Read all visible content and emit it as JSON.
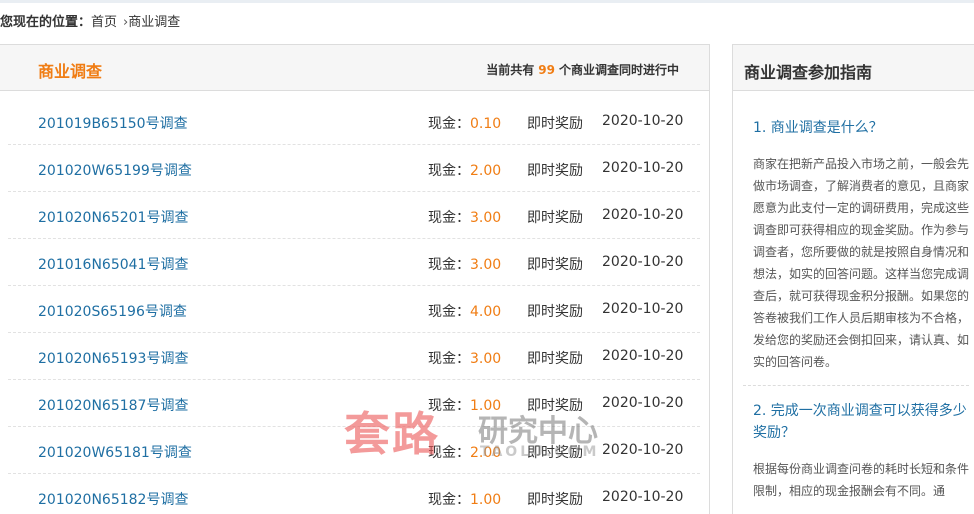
{
  "breadcrumb": {
    "lead": "您现在的位置：",
    "home": "首页",
    "separator": "›",
    "current": "商业调查"
  },
  "main": {
    "title": "商业调查",
    "count_prefix": "当前共有",
    "count": "99",
    "count_suffix": "个商业调查同时进行中",
    "rows": [
      {
        "title": "201019B65150号调查",
        "cash_label": "现金：",
        "amount": "0.10",
        "reward": "即时奖励",
        "date": "2020-10-20"
      },
      {
        "title": "201020W65199号调查",
        "cash_label": "现金：",
        "amount": "2.00",
        "reward": "即时奖励",
        "date": "2020-10-20"
      },
      {
        "title": "201020N65201号调查",
        "cash_label": "现金：",
        "amount": "3.00",
        "reward": "即时奖励",
        "date": "2020-10-20"
      },
      {
        "title": "201016N65041号调查",
        "cash_label": "现金：",
        "amount": "3.00",
        "reward": "即时奖励",
        "date": "2020-10-20"
      },
      {
        "title": "201020S65196号调查",
        "cash_label": "现金：",
        "amount": "4.00",
        "reward": "即时奖励",
        "date": "2020-10-20"
      },
      {
        "title": "201020N65193号调查",
        "cash_label": "现金：",
        "amount": "3.00",
        "reward": "即时奖励",
        "date": "2020-10-20"
      },
      {
        "title": "201020N65187号调查",
        "cash_label": "现金：",
        "amount": "1.00",
        "reward": "即时奖励",
        "date": "2020-10-20"
      },
      {
        "title": "201020W65181号调查",
        "cash_label": "现金：",
        "amount": "2.00",
        "reward": "即时奖励",
        "date": "2020-10-20"
      },
      {
        "title": "201020N65182号调查",
        "cash_label": "现金：",
        "amount": "1.00",
        "reward": "即时奖励",
        "date": "2020-10-20"
      }
    ]
  },
  "guide": {
    "title": "商业调查参加指南",
    "q1": "1. 商业调查是什么？",
    "a1": "商家在把新产品投入市场之前，一般会先做市场调查，了解消费者的意见，且商家愿意为此支付一定的调研费用，完成这些调查即可获得相应的现金奖励。作为参与调查者，您所要做的就是按照自身情况和想法，如实的回答问题。这样当您完成调查后，就可获得现金积分报酬。如果您的答卷被我们工作人员后期审核为不合格，发给您的奖励还会倒扣回来，请认真、如实的回答问卷。",
    "q2": "2. 完成一次商业调查可以获得多少奖励？",
    "a2": "根据每份商业调查问卷的耗时长短和条件限制，相应的现金报酬会有不同。通"
  },
  "watermark": {
    "red": "套路",
    "gray": "研究中心",
    "url": "TAOLU.COM"
  },
  "colors": {
    "accent": "#f07d14",
    "link": "#1f6fa3",
    "header_bg": "#f6f6f6",
    "border": "#dcdcdc"
  }
}
